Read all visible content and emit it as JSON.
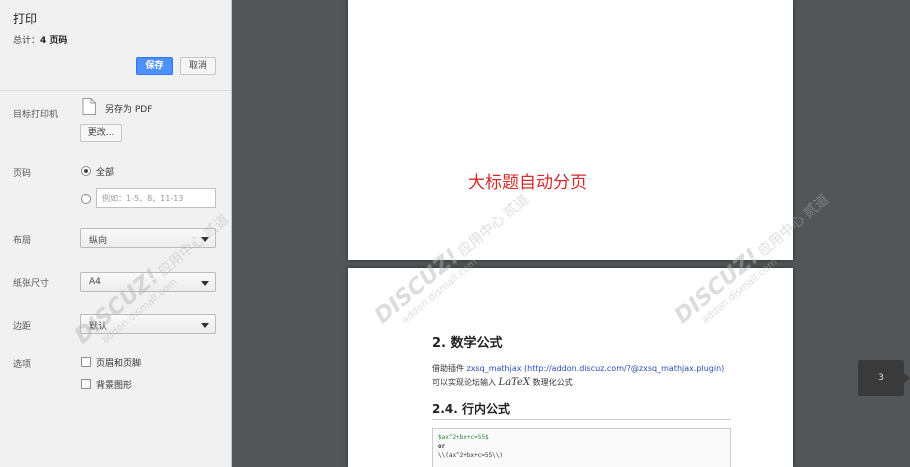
{
  "sidebar": {
    "title": "打印",
    "total_prefix": "总计：",
    "total_value": "4 页码",
    "save_label": "保存",
    "cancel_label": "取消",
    "destination": {
      "label": "目标打印机",
      "name": "另存为 PDF",
      "change_label": "更改..."
    },
    "pages": {
      "label": "页码",
      "all_label": "全部",
      "range_placeholder": "例如：1-5、8、11-13"
    },
    "layout": {
      "label": "布局",
      "value": "纵向"
    },
    "paper": {
      "label": "纸张尺寸",
      "value": "A4"
    },
    "margins": {
      "label": "边距",
      "value": "默认"
    },
    "options": {
      "label": "选项",
      "header_footer": "页眉和页脚",
      "background": "背景图形"
    }
  },
  "preview": {
    "page1_heading": "大标题自动分页",
    "h2_math": "2. 数学公式",
    "desc1_prefix": "借助插件 ",
    "desc1_link": "zxsq_mathjax (http://addon.discuz.com/?@zxsq_mathjax.plugin)",
    "desc2_prefix": "可以实现论坛输入 ",
    "desc2_latex": "LaTeX",
    "desc2_suffix": " 数理化公式",
    "h2_inline": "2.4. 行内公式",
    "code_line1": "$ax^2+bx+c=55$",
    "code_line2": "or",
    "code_line3": "\\\\(ax^2+bx+c=55\\\\)",
    "page_indicator": "3"
  },
  "watermark": {
    "brand": "DISCUZ!",
    "cn": "应用中心",
    "author": "贰道",
    "url": "addon.dismall.com"
  },
  "colors": {
    "accent": "#4d90fe",
    "heading_red": "#d42a2a",
    "link_blue": "#2a4cbb",
    "preview_bg": "#525659"
  },
  "icons": {
    "destination": "pdf-document-icon"
  }
}
